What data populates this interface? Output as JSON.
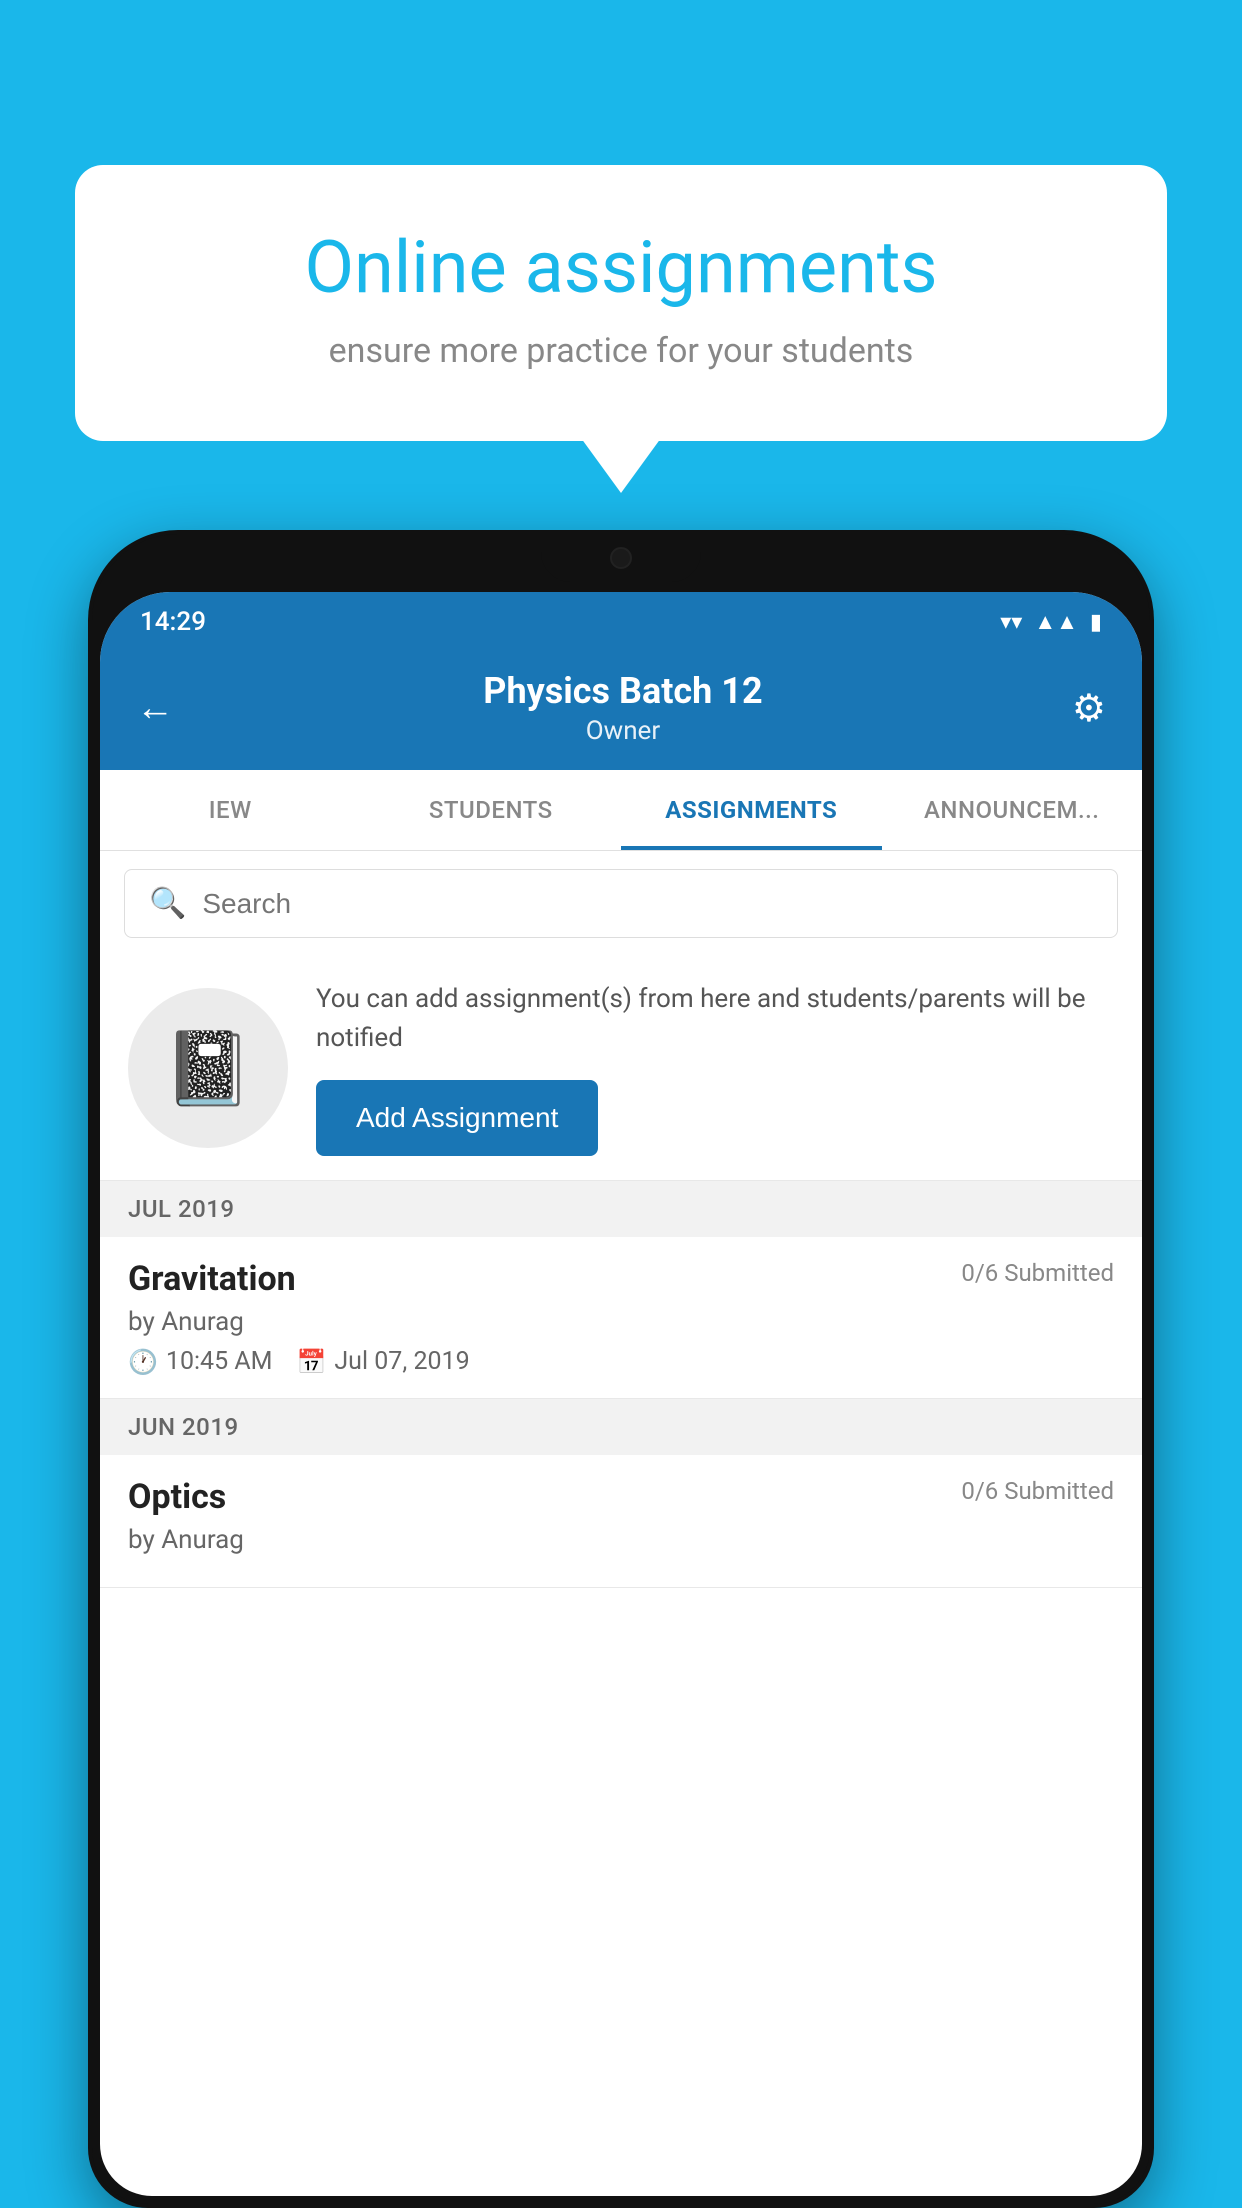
{
  "background_color": "#1ab7ea",
  "speech_bubble": {
    "title": "Online assignments",
    "subtitle": "ensure more practice for your students"
  },
  "status_bar": {
    "time": "14:29",
    "icons": [
      "wifi",
      "signal",
      "battery"
    ]
  },
  "header": {
    "title": "Physics Batch 12",
    "subtitle": "Owner",
    "back_label": "←",
    "gear_label": "⚙"
  },
  "tabs": [
    {
      "label": "IEW",
      "active": false
    },
    {
      "label": "STUDENTS",
      "active": false
    },
    {
      "label": "ASSIGNMENTS",
      "active": true
    },
    {
      "label": "ANNOUNCEM...",
      "active": false
    }
  ],
  "search": {
    "placeholder": "Search"
  },
  "add_assignment_section": {
    "description": "You can add assignment(s) from here and students/parents will be notified",
    "button_label": "Add Assignment"
  },
  "sections": [
    {
      "header": "JUL 2019",
      "items": [
        {
          "name": "Gravitation",
          "submitted": "0/6 Submitted",
          "author": "by Anurag",
          "time": "10:45 AM",
          "date": "Jul 07, 2019"
        }
      ]
    },
    {
      "header": "JUN 2019",
      "items": [
        {
          "name": "Optics",
          "submitted": "0/6 Submitted",
          "author": "by Anurag",
          "time": "",
          "date": ""
        }
      ]
    }
  ]
}
